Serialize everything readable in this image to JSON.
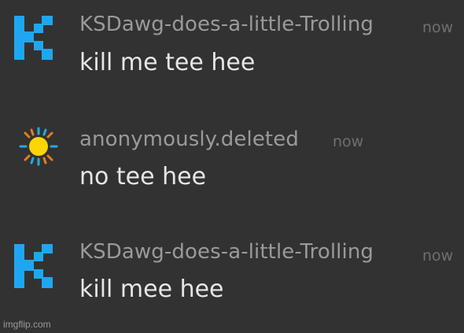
{
  "colors": {
    "background": "#323232",
    "username": "#9a9a9a",
    "timestamp": "#6f6f6f",
    "message_text": "#e6e6e6",
    "k_avatar": "#1ea7f0",
    "sun_core": "#ffd500",
    "sun_rays_blue": "#29a8e0",
    "sun_rays_orange": "#e87b1d"
  },
  "messages": [
    {
      "avatar_icon": "k-logo-icon",
      "username": "KSDawg-does-a-little-Trolling",
      "timestamp": "now",
      "text": "kill me tee hee"
    },
    {
      "avatar_icon": "sun-icon",
      "username": "anonymously.deleted",
      "timestamp": "now",
      "text": "no tee hee"
    },
    {
      "avatar_icon": "k-logo-icon",
      "username": "KSDawg-does-a-little-Trolling",
      "timestamp": "now",
      "text": "kill mee hee"
    }
  ],
  "watermark": "imgflip.com"
}
